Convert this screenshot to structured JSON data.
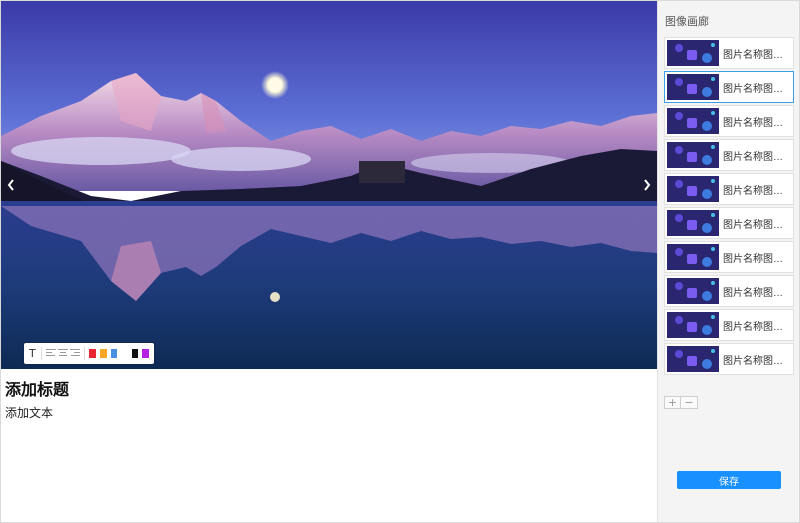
{
  "viewer": {
    "image": "mountain-lake-night-photo",
    "prev_icon": "chevron-left-icon",
    "next_icon": "chevron-right-icon"
  },
  "toolbar": {
    "text_tool": "T",
    "align_icons": [
      "align-left-icon",
      "align-center-icon",
      "align-right-icon"
    ],
    "colors": [
      "#e8262f",
      "#f5a623",
      "#4a90e2",
      "#ffffff",
      "#111111",
      "#b620e0"
    ]
  },
  "caption": {
    "title": "添加标题",
    "text": "添加文本"
  },
  "sidebar": {
    "title": "图像画廊",
    "thumbnails": [
      {
        "label": "图片名称图片..."
      },
      {
        "label": "图片名称图片..."
      },
      {
        "label": "图片名称图片..."
      },
      {
        "label": "图片名称图片..."
      },
      {
        "label": "图片名称图片..."
      },
      {
        "label": "图片名称图片..."
      },
      {
        "label": "图片名称图片..."
      },
      {
        "label": "图片名称图片..."
      },
      {
        "label": "图片名称图片..."
      },
      {
        "label": "图片名称图片..."
      }
    ],
    "active_index": 1,
    "add_label": "+",
    "remove_label": "−",
    "save_label": "保存"
  },
  "colors": {
    "accent": "#1890ff",
    "active_border": "#3aa0e8"
  }
}
